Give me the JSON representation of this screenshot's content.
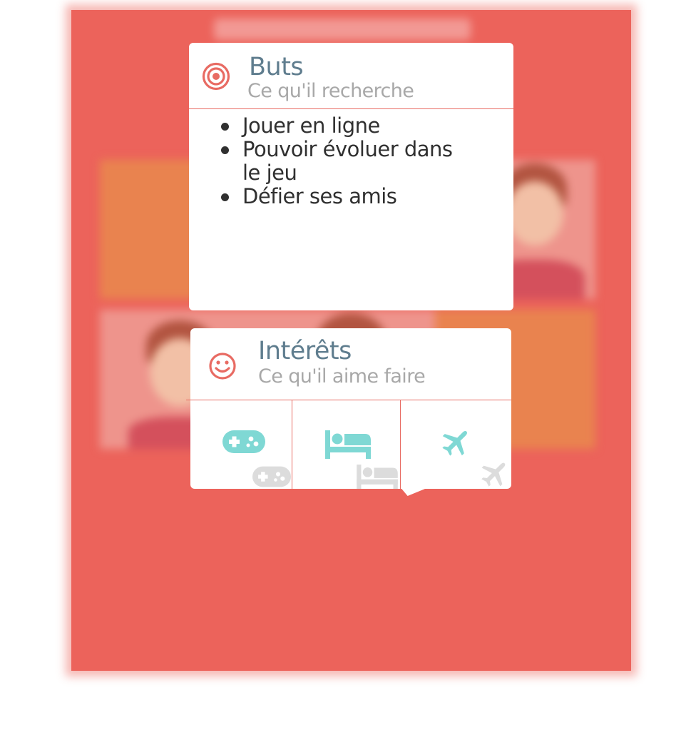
{
  "colors": {
    "background_red": "#ec635b",
    "accent_red": "#e86b63",
    "title_blue_gray": "#5f7d8e",
    "subtitle_gray": "#a8a8a8",
    "icon_teal": "#7fd8d4",
    "icon_light_gray": "#dcdcdc",
    "tile_orange": "#e9834f",
    "tile_pink": "#ee948c"
  },
  "goals": {
    "icon": "target-icon",
    "title": "Buts",
    "subtitle": "Ce qu'il recherche",
    "items": [
      "Jouer en ligne",
      "Pouvoir évoluer dans le jeu",
      "Défier ses amis"
    ]
  },
  "interests": {
    "icon": "smiley-icon",
    "title": "Intérêts",
    "subtitle": "Ce qu'il aime faire",
    "items": [
      {
        "icon": "gamepad-icon"
      },
      {
        "icon": "bed-icon"
      },
      {
        "icon": "airplane-icon"
      }
    ]
  }
}
